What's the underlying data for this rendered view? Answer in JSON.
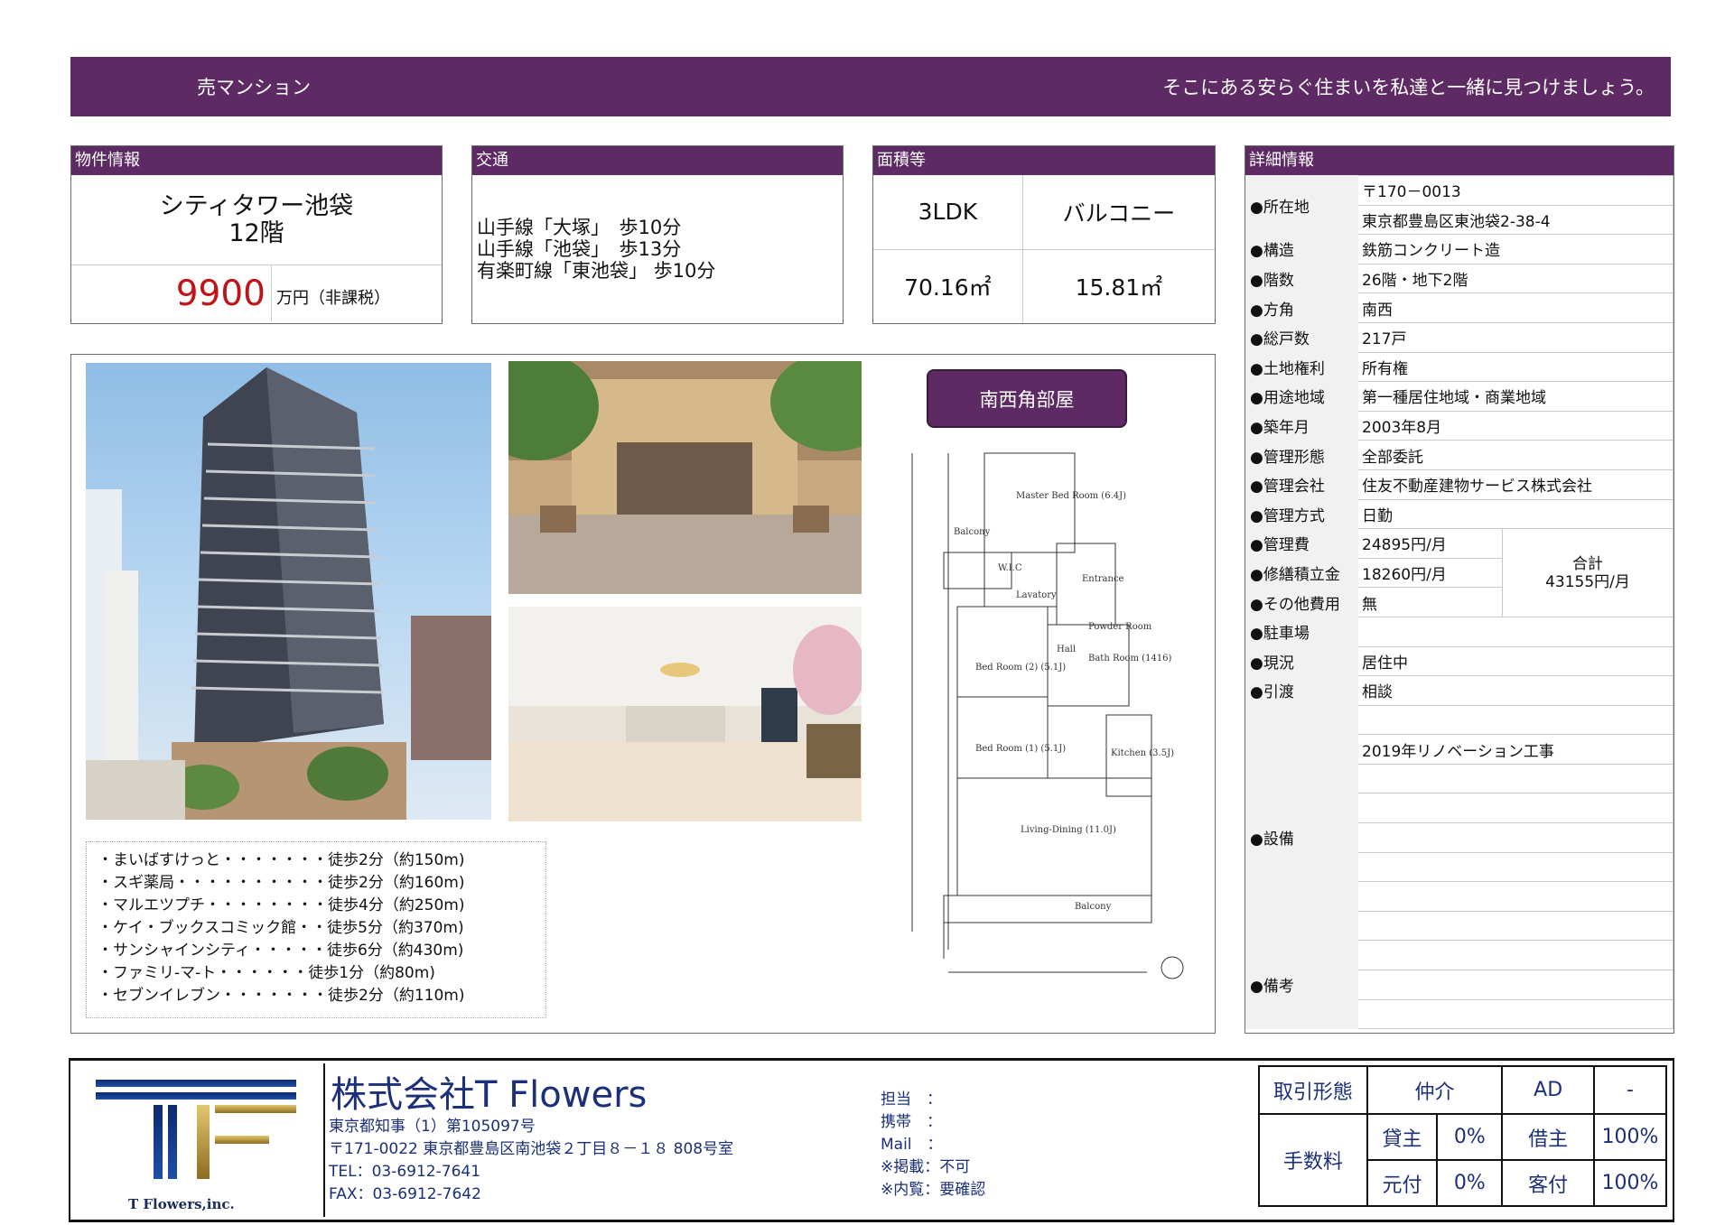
{
  "banner": {
    "left": "売マンション",
    "right": "そこにある安らぐ住まいを私達と一緒に見つけましょう。"
  },
  "property": {
    "header": "物件情報",
    "name": "シティタワー池袋",
    "floor": "12階",
    "price": "9900",
    "price_unit": "万円（非課税）"
  },
  "transport": {
    "header": "交通",
    "lines": [
      "山手線「大塚」　歩10分",
      "山手線「池袋」　歩13分",
      "有楽町線「東池袋」 歩10分"
    ]
  },
  "area": {
    "header": "面積等",
    "layout": "3LDK",
    "balcony_label": "バルコニー",
    "floor_area": "70.16㎡",
    "balcony_area": "15.81㎡"
  },
  "details": {
    "header": "詳細情報",
    "postal": "〒170－0013",
    "address": "東京都豊島区東池袋2-38-4",
    "rows": [
      {
        "label": "●構造",
        "value": "鉄筋コンクリート造"
      },
      {
        "label": "●階数",
        "value": "26階・地下2階"
      },
      {
        "label": "●方角",
        "value": "南西"
      },
      {
        "label": "●総戸数",
        "value": "217戸"
      },
      {
        "label": "●土地権利",
        "value": "所有権"
      },
      {
        "label": "●用途地域",
        "value": "第一種居住地域・商業地域"
      },
      {
        "label": "●築年月",
        "value": "2003年8月"
      },
      {
        "label": "●管理形態",
        "value": "全部委託"
      },
      {
        "label": "●管理会社",
        "value": "住友不動産建物サービス株式会社"
      },
      {
        "label": "●管理方式",
        "value": "日勤"
      }
    ],
    "location_label": "●所在地",
    "fee_rows": [
      {
        "label": "●管理費",
        "value": "24895円/月"
      },
      {
        "label": "●修繕積立金",
        "value": "18260円/月"
      },
      {
        "label": "●その他費用",
        "value": "無"
      }
    ],
    "total_label": "合計",
    "total_value": "43155円/月",
    "parking_label": "●駐車場",
    "status_label": "●現況",
    "status_value": "居住中",
    "handover_label": "●引渡",
    "handover_value": "相談",
    "equip_label": "●設備",
    "equip_value": "2019年リノベーション工事",
    "notes_label": "●備考"
  },
  "floorplan": {
    "badge": "南西角部屋",
    "rooms": [
      "Master Bed Room (6.4J)",
      "Balcony",
      "W.I.C",
      "Entrance",
      "Lavatory",
      "Hall",
      "Powder Room",
      "Bath Room (1416)",
      "Bed Room (2) (5.1J)",
      "Bed Room (1) (5.1J)",
      "Kitchen (3.5J)",
      "Living-Dining (11.0J)",
      "Balcony"
    ]
  },
  "nearby": [
    "・まいばすけっと・・・・・・・徒歩2分（約150m)",
    "・スギ薬局・・・・・・・・・・徒歩2分（約160m)",
    "・マルエツプチ・・・・・・・・徒歩4分（約250m)",
    "・ケイ・ブックスコミック館・・徒歩5分（約370m)",
    "・サンシャインシティ・・・・・徒歩6分（約430m)",
    "・ファミリ-マ-ト・・・・・・徒歩1分（約80m)",
    "・セブンイレブン・・・・・・・徒歩2分（約110m)"
  ],
  "company": {
    "name": "株式会社T Flowers",
    "logo_caption": "T Flowers,inc.",
    "license": "東京都知事（1）第105097号",
    "address": "〒171-0022 東京都豊島区南池袋２丁目８－１８ 808号室",
    "tel": "TEL：03-6912-7641",
    "fax": "FAX：03-6912-7642"
  },
  "contact": {
    "tantou": "担当　：",
    "keitai": "携帯　：",
    "mail": "Mail　：",
    "keisai": "※掲載：不可",
    "naiken": "※内覧：要確認"
  },
  "fees": {
    "torihiki": "取引形態",
    "chukai": "仲介",
    "ad": "AD",
    "dash": "-",
    "tesuryo": "手数料",
    "kashinushi": "貸主",
    "kashinushi_pct": "0%",
    "karinushi": "借主",
    "karinushi_pct": "100%",
    "motozuke": "元付",
    "motozuke_pct": "0%",
    "kyakuzuke": "客付",
    "kyakuzuke_pct": "100%"
  },
  "colors": {
    "accent": "#5e2a63",
    "price": "#c0141a"
  }
}
